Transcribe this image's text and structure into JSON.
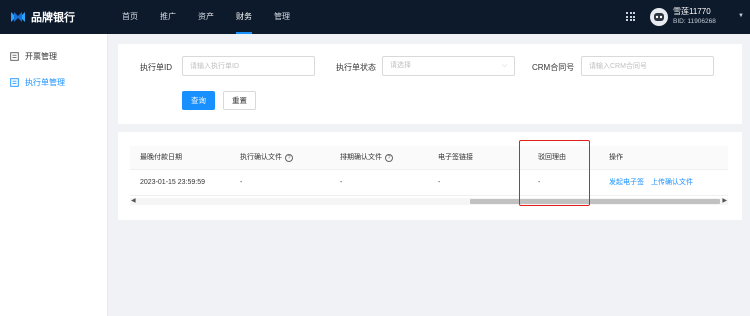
{
  "brand": {
    "name": "品牌银行",
    "accent": "#1890ff"
  },
  "nav": [
    {
      "label": "首页",
      "active": false
    },
    {
      "label": "推广",
      "active": false
    },
    {
      "label": "资产",
      "active": false
    },
    {
      "label": "财务",
      "active": true
    },
    {
      "label": "管理",
      "active": false
    }
  ],
  "user": {
    "name": "雪莲11770",
    "bid": "BID: 11906268"
  },
  "sidebar": {
    "items": [
      {
        "label": "开票管理",
        "icon": "invoice-icon",
        "active": false
      },
      {
        "label": "执行单管理",
        "icon": "document-icon",
        "active": true
      }
    ]
  },
  "filters": {
    "exec_id": {
      "label": "执行单ID",
      "placeholder": "请输入执行单ID"
    },
    "exec_status": {
      "label": "执行单状态",
      "placeholder": "请选择"
    },
    "crm_contract": {
      "label": "CRM合同号",
      "placeholder": "请输入CRM合同号"
    },
    "query_label": "查询",
    "reset_label": "重置"
  },
  "table": {
    "columns": [
      "最晚付款日期",
      "执行确认文件",
      "排期确认文件",
      "电子签链接",
      "驳回理由",
      "操作"
    ],
    "rows": [
      {
        "last_pay_date": "2023-01-15 23:59:59",
        "exec_confirm_file": "-",
        "schedule_confirm_file": "-",
        "esign_link": "-",
        "reject_reason": "-",
        "actions": [
          "发起电子签",
          "上传确认文件"
        ]
      }
    ]
  }
}
